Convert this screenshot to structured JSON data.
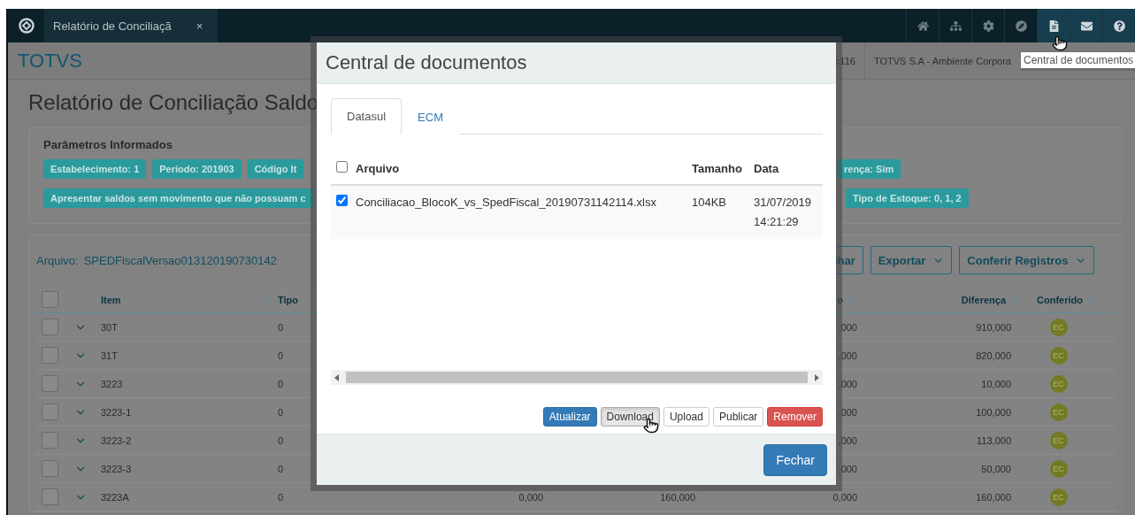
{
  "top_bar": {
    "tabs": [
      {
        "label": "Relatório de Conciliaçã",
        "close": "×",
        "selected": true
      }
    ]
  },
  "header": {
    "logo": "TOTVS",
    "context": [
      "c116",
      "TOTVS S.A - Ambiente Corpora"
    ]
  },
  "tooltip": "Central de documentos",
  "page": {
    "title": "Relatório de Conciliação Saldo",
    "parameters": {
      "title": "Parâmetros Informados",
      "chip_rows": [
        {
          "left": [
            "Estabelecimento: 1",
            "Período: 201903",
            "Código It"
          ],
          "right": [
            "rença: Sim"
          ]
        },
        {
          "left": [
            "Apresentar saldos sem movimento que não possuam c"
          ],
          "right": [
            "Tipo de Estoque: 0, 1, 2"
          ]
        }
      ]
    },
    "file_panel": {
      "label": "Arquivo:",
      "file_name": "SPEDFiscalVersao013120190730142",
      "buttons": [
        {
          "label": "lhar",
          "caret": false
        },
        {
          "label": "Exportar",
          "caret": true
        },
        {
          "label": "Conferir Registros",
          "caret": true
        }
      ]
    },
    "table": {
      "all_checked": false,
      "columns": {
        "item": "Item",
        "tipo": "Tipo",
        "column_5": "o",
        "diferenca": "Diferença",
        "conferido": "Conferido"
      },
      "rows": [
        {
          "checked": false,
          "item": "30T",
          "tipo": "0",
          "column_5": ",000",
          "diferenca": "910,000",
          "conferido": "EC"
        },
        {
          "checked": false,
          "item": "31T",
          "tipo": "0",
          "column_5": ",000",
          "diferenca": "820,000",
          "conferido": "EC"
        },
        {
          "checked": false,
          "item": "3223",
          "tipo": "0",
          "column_5": ",000",
          "diferenca": "10,000",
          "conferido": "EC"
        },
        {
          "checked": false,
          "item": "3223-1",
          "tipo": "0",
          "column_5": ",000",
          "diferenca": "100,000",
          "conferido": "EC"
        },
        {
          "checked": false,
          "item": "3223-2",
          "tipo": "0",
          "column_5": ",000",
          "diferenca": "113,000",
          "conferido": "EC"
        },
        {
          "checked": false,
          "item": "3223-3",
          "tipo": "0",
          "column_5": ",000",
          "diferenca": "50,000",
          "conferido": "EC"
        },
        {
          "checked": false,
          "item": "3223A",
          "tipo": "0",
          "column_3": "0,000",
          "column_4": "160,000",
          "column_5": "0,000",
          "diferenca": "160,000",
          "conferido": "EC"
        }
      ]
    }
  },
  "modal": {
    "title": "Central de documentos",
    "tabs": [
      {
        "label": "Datasul",
        "selected": true
      },
      {
        "label": "ECM",
        "selected": false
      }
    ],
    "all_checked": false,
    "columns": [
      "Arquivo",
      "Tamanho",
      "Data"
    ],
    "files": [
      {
        "checked": true,
        "name": "Conciliacao_BlocoK_vs_SpedFiscal_20190731142114.xlsx",
        "size": "104KB",
        "date": "31/07/2019 14:21:29"
      }
    ],
    "actions": [
      {
        "label": "Atualizar",
        "kind": "primary"
      },
      {
        "label": "Download",
        "kind": "pressed"
      },
      {
        "label": "Upload",
        "kind": "default"
      },
      {
        "label": "Publicar",
        "kind": "default"
      },
      {
        "label": "Remover",
        "kind": "danger"
      }
    ],
    "close": "Fechar"
  }
}
